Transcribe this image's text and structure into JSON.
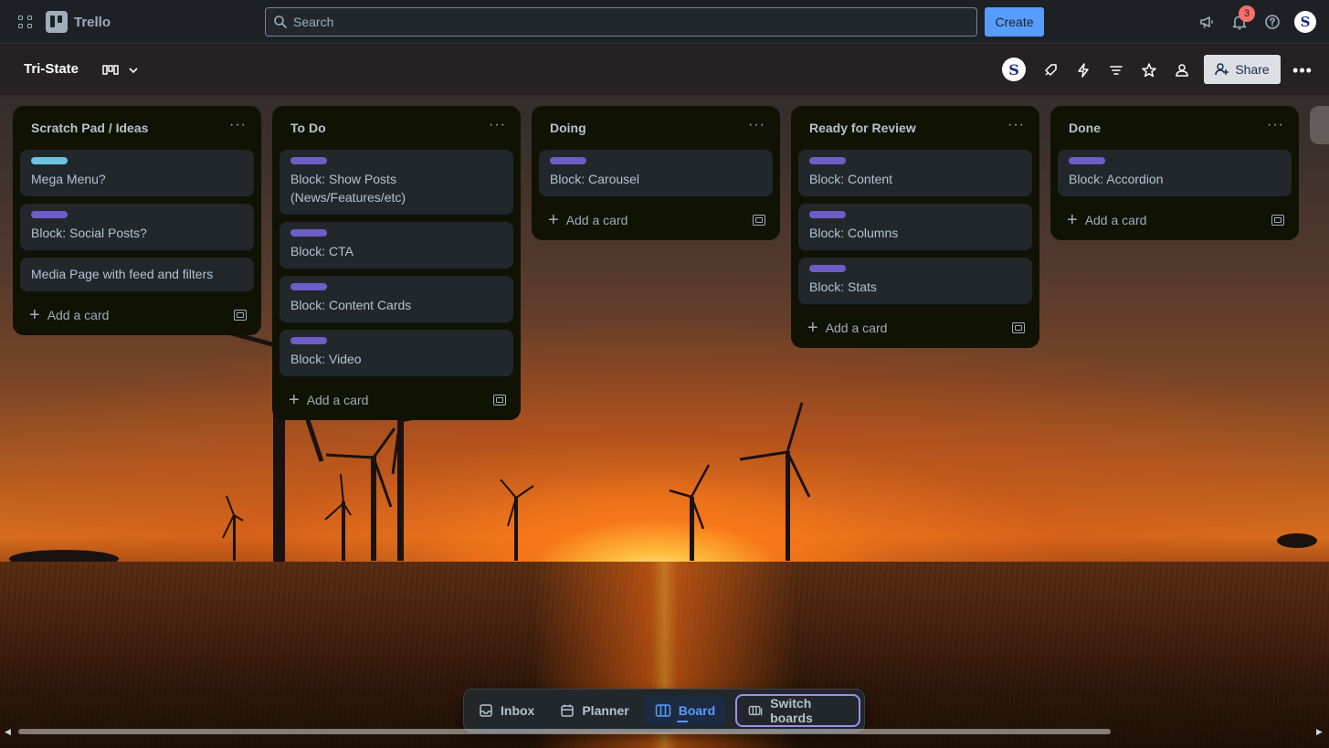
{
  "topnav": {
    "app_name": "Trello",
    "search_placeholder": "Search",
    "create_label": "Create",
    "notification_count": "3",
    "avatar_letter": "S"
  },
  "board": {
    "title": "Tri-State",
    "share_label": "Share",
    "member_avatar_letter": "S"
  },
  "lists": [
    {
      "title": "Scratch Pad / Ideas",
      "cards": [
        {
          "label_color": "#6cc3e0",
          "title": "Mega Menu?"
        },
        {
          "label_color": "#6e5dc6",
          "title": "Block: Social Posts?"
        },
        {
          "label_color": "",
          "title": "Media Page with feed and filters"
        }
      ],
      "add_label": "Add a card"
    },
    {
      "title": "To Do",
      "cards": [
        {
          "label_color": "#6e5dc6",
          "title": "Block: Show Posts (News/Features/etc)"
        },
        {
          "label_color": "#6e5dc6",
          "title": "Block: CTA"
        },
        {
          "label_color": "#6e5dc6",
          "title": "Block: Content Cards"
        },
        {
          "label_color": "#6e5dc6",
          "title": "Block: Video"
        }
      ],
      "add_label": "Add a card"
    },
    {
      "title": "Doing",
      "cards": [
        {
          "label_color": "#6e5dc6",
          "title": "Block: Carousel"
        }
      ],
      "add_label": "Add a card"
    },
    {
      "title": "Ready for Review",
      "cards": [
        {
          "label_color": "#6e5dc6",
          "title": "Block: Content"
        },
        {
          "label_color": "#6e5dc6",
          "title": "Block: Columns"
        },
        {
          "label_color": "#6e5dc6",
          "title": "Block: Stats"
        }
      ],
      "add_label": "Add a card"
    },
    {
      "title": "Done",
      "cards": [
        {
          "label_color": "#6e5dc6",
          "title": "Block: Accordion"
        }
      ],
      "add_label": "Add a card"
    }
  ],
  "switcher": {
    "inbox_label": "Inbox",
    "planner_label": "Planner",
    "board_label": "Board",
    "switch_label": "Switch boards"
  },
  "colors": {
    "accent": "#579dff",
    "label_purple": "#6e5dc6",
    "label_sky": "#6cc3e0",
    "list_bg": "#101204",
    "card_bg": "#22272b"
  }
}
